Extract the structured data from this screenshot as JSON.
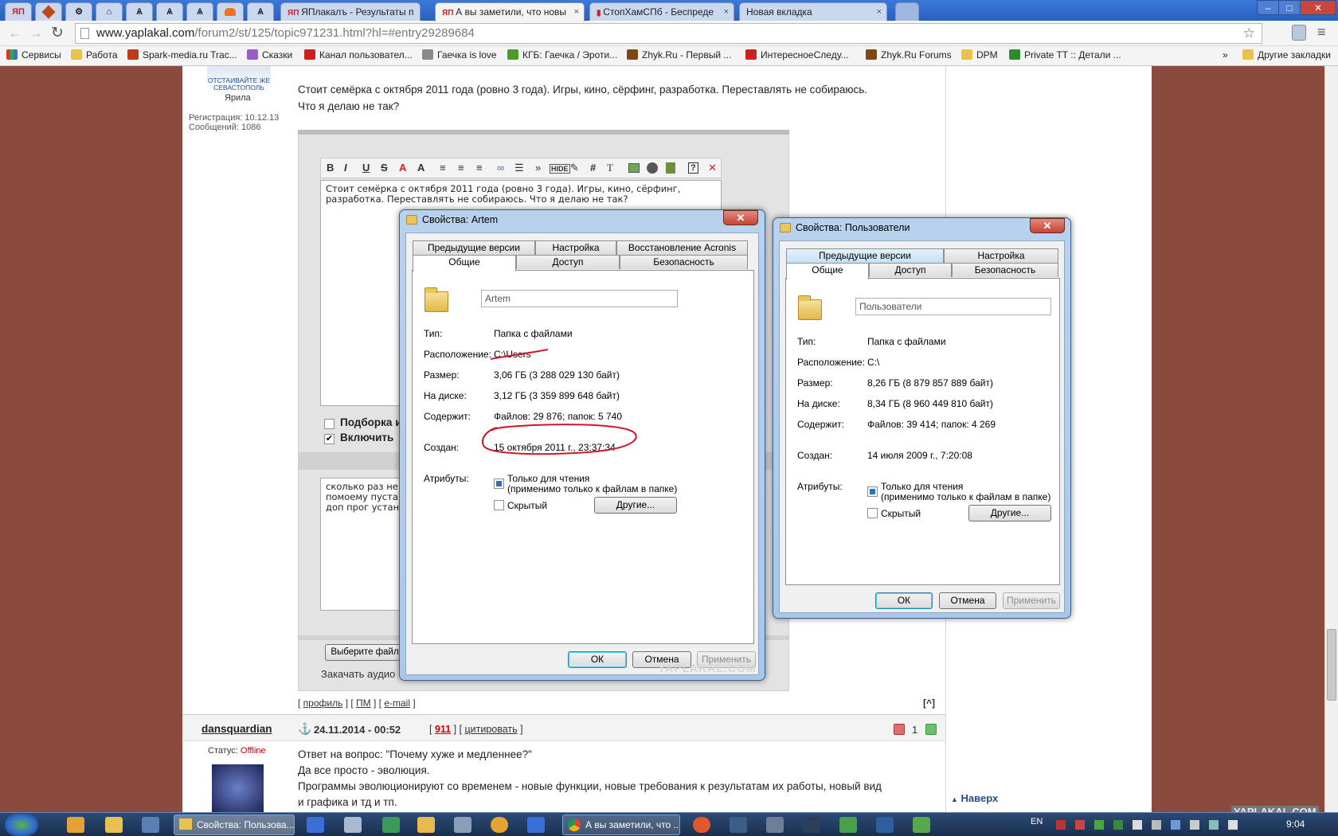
{
  "browser": {
    "tabs": [
      {
        "label": "ЯП",
        "pinned": true
      },
      {
        "label": "",
        "pinned": true
      },
      {
        "label": "",
        "pinned": true
      },
      {
        "label": "",
        "pinned": true
      },
      {
        "label": "",
        "pinned": true
      },
      {
        "label": "",
        "pinned": true
      },
      {
        "label": "",
        "pinned": true
      },
      {
        "label": "",
        "pinned": true
      },
      {
        "label": "",
        "pinned": true
      },
      {
        "label": "ЯПлакалъ - Результаты п",
        "pinned": false
      },
      {
        "label": "А вы заметили, что новы",
        "pinned": false,
        "active": true
      },
      {
        "label": "СтопХамСПб - Беспреде",
        "pinned": false
      },
      {
        "label": "Новая вкладка",
        "pinned": false
      }
    ],
    "tab_close": "×",
    "window_controls": {
      "minimize": "–",
      "maximize": "□",
      "close": "✕"
    },
    "url_host": "www.yaplakal.com",
    "url_path": "/forum2/st/125/topic971231.html?hl=#entry29289684",
    "bookmarks": [
      {
        "label": "Сервисы",
        "color": "#d13b2e"
      },
      {
        "label": "Работа",
        "color": "#e8c14f"
      },
      {
        "label": "Spark-media.ru Trac...",
        "color": "#c03a1c"
      },
      {
        "label": "Сказки",
        "color": "#9a5fc7"
      },
      {
        "label": "Канал пользовател...",
        "color": "#cc1f1f"
      },
      {
        "label": "Гаечка is love",
        "color": "#8a8a8a"
      },
      {
        "label": "КГБ: Гаечка / Эроти...",
        "color": "#4c9a2a"
      },
      {
        "label": "Zhyk.Ru - Первый ...",
        "color": "#7a4a16"
      },
      {
        "label": "ИнтересноеСледу...",
        "color": "#cc1f1f"
      },
      {
        "label": "Zhyk.Ru Forums",
        "color": "#7a4a16"
      },
      {
        "label": "DPM",
        "color": "#e8c14f"
      },
      {
        "label": "Private TT :: Детали ...",
        "color": "#2f8a2f"
      }
    ],
    "bookmarks_more": "»",
    "other_bookmarks": "Другие закладки"
  },
  "post1": {
    "avatar_caption": "ОТСТАИВАЙТЕ ЖЕ СЕВАСТОПОЛЬ",
    "user_rank": "Ярила",
    "registration": "Регистрация: 10.12.13",
    "messages": "Сообщений: 1086",
    "text_line1": "Стоит семёрка с октября 2011 года (ровно 3 года). Игры, кино, сёрфинг, разработка. Переставлять не собираюсь.",
    "text_line2": "Что я делаю не так?",
    "editor_line1": "Стоит семёрка с  октября 2011 года (ровно 3 года). Игры, кино, сёрфинг,",
    "editor_line2": "разработка.  Переставлять не собираюсь.  Что я делаю не так?",
    "option1": "Подборка и",
    "option2": "Включить",
    "reply_line1": "сколько раз не",
    "reply_line2": "помоему пустая",
    "reply_line3": "доп прог устано",
    "choose_file": "Выберите файл",
    "upload_audio": "Закачать аудио",
    "links": {
      "profile": "профиль",
      "pm": "ПМ",
      "email": "e-mail"
    },
    "to_top_icon": "[^]"
  },
  "post2": {
    "username": "dansquardian",
    "status_label": "Статус:",
    "status_value": "Offline",
    "date": "24.11.2014 - 00:52",
    "post_number": "911",
    "quote": "цитировать",
    "rating": "1",
    "text_line1": "Ответ на вопрос: \"Почему хуже и медленнее?\"",
    "text_line2": "Да все просто - эволюция.",
    "text_line3": "Программы эволюционируют со временем - новые функции, новые требования к результатам их работы, новый вид",
    "text_line4": "и графика и тд и тп."
  },
  "sidebar": {
    "to_top": "Наверх"
  },
  "watermark": "YAPLAKAL.COM",
  "dialog_artem": {
    "title": "Свойства: Artem",
    "tabs_row1": [
      "Предыдущие версии",
      "Настройка",
      "Восстановление Acronis"
    ],
    "tabs_row2": [
      "Общие",
      "Доступ",
      "Безопасность"
    ],
    "name": "Artem",
    "labels": {
      "type": "Тип:",
      "location": "Расположение:",
      "size": "Размер:",
      "on_disk": "На диске:",
      "contains": "Содержит:",
      "created": "Создан:",
      "attributes": "Атрибуты:"
    },
    "type": "Папка с файлами",
    "location": "C:\\Users",
    "size": "3,06 ГБ (3 288 029 130 байт)",
    "on_disk": "3,12 ГБ (3 359 899 648 байт)",
    "contains": "Файлов: 29 876; папок: 5 740",
    "created": "15 октября 2011 г., 23:37:34",
    "readonly": "Только для чтения",
    "readonly_note": "(применимо только к файлам в папке)",
    "hidden": "Скрытый",
    "other_button": "Другие...",
    "ok": "ОК",
    "cancel": "Отмена",
    "apply": "Применить"
  },
  "dialog_users": {
    "title": "Свойства: Пользователи",
    "tabs_row1": [
      "Предыдущие версии",
      "Настройка"
    ],
    "tabs_row2": [
      "Общие",
      "Доступ",
      "Безопасность"
    ],
    "name": "Пользователи",
    "labels": {
      "type": "Тип:",
      "location": "Расположение:",
      "size": "Размер:",
      "on_disk": "На диске:",
      "contains": "Содержит:",
      "created": "Создан:",
      "attributes": "Атрибуты:"
    },
    "type": "Папка с файлами",
    "location": "C:\\",
    "size": "8,26 ГБ (8 879 857 889 байт)",
    "on_disk": "8,34 ГБ (8 960 449 810 байт)",
    "contains": "Файлов: 39 414; папок: 4 269",
    "created": "14 июля 2009 г., 7:20:08",
    "readonly": "Только для чтения",
    "readonly_note": "(применимо только к файлам в папке)",
    "hidden": "Скрытый",
    "other_button": "Другие...",
    "ok": "ОК",
    "cancel": "Отмена",
    "apply": "Применить"
  },
  "taskbar": {
    "item_explorer": "Свойства: Пользова...",
    "item_chrome": "А вы заметили, что ...",
    "lang": "EN",
    "clock": "9:04"
  }
}
